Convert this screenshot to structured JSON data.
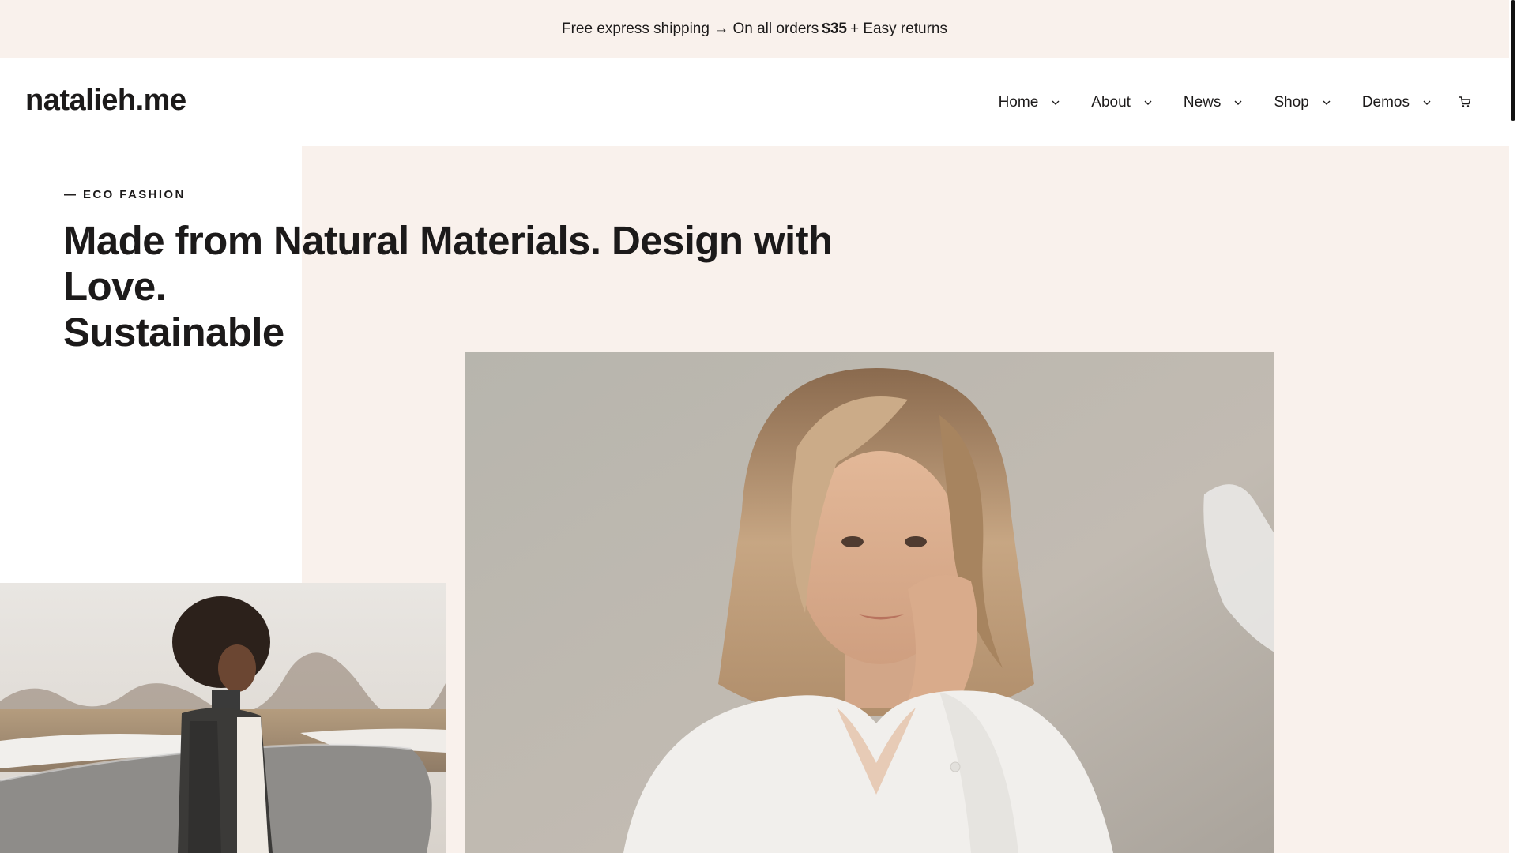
{
  "announcement": {
    "text_before": "Free express shipping → On all orders",
    "price": "$35",
    "text_after": "+ Easy returns"
  },
  "header": {
    "logo": "natalieh.me",
    "nav": [
      {
        "label": "Home"
      },
      {
        "label": "About"
      },
      {
        "label": "News"
      },
      {
        "label": "Shop"
      },
      {
        "label": "Demos"
      }
    ],
    "cart_icon": "cart-icon"
  },
  "hero": {
    "eyebrow": "— ECO FASHION",
    "headline_line1": "Made from Natural Materials. Design with Love.",
    "headline_line2": "Sustainable"
  },
  "colors": {
    "accent_bg": "#f9f1ec",
    "text": "#1c1a1a"
  }
}
